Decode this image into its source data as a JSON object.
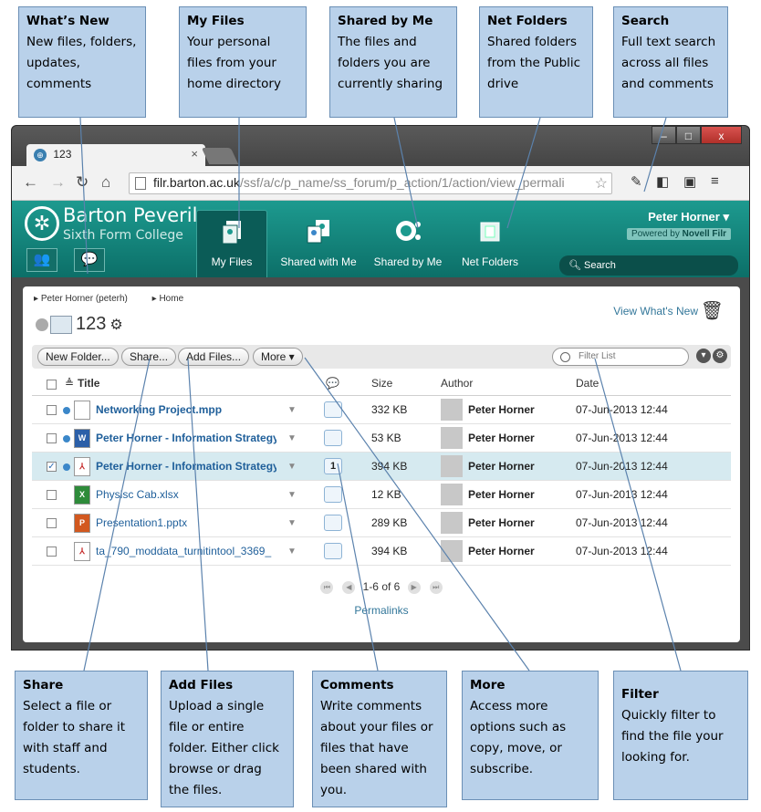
{
  "callouts_top": [
    {
      "title": "What’s New",
      "body": "New files, folders,\nupdates,\ncomments"
    },
    {
      "title": "My Files",
      "body": "Your personal\nfiles from your\nhome directory"
    },
    {
      "title": "Shared by Me",
      "body": "The files and\nfolders you are\ncurrently sharing"
    },
    {
      "title": "Net Folders",
      "body": "Shared folders\nfrom the Public\ndrive"
    },
    {
      "title": "Search",
      "body": "Full text search\nacross all files\nand comments"
    }
  ],
  "callouts_bottom": [
    {
      "title": "Share",
      "body": "Select a file or\nfolder to share it\nwith staff and\nstudents."
    },
    {
      "title": "Add Files",
      "body": "Upload a single\nfile or entire\nfolder. Either click\nbrowse or drag\nthe files."
    },
    {
      "title": "Comments",
      "body": "Write comments\nabout your files or\nfiles that have\nbeen shared with\nyou."
    },
    {
      "title": "More",
      "body": "Access more\noptions such as\ncopy, move, or\nsubscribe."
    },
    {
      "title": "Filter",
      "body": "Quickly filter to\nfind the file your\nlooking for."
    }
  ],
  "browser": {
    "tab_title": "123",
    "tab_close": "×",
    "url_host": "filr.barton.ac.uk",
    "url_path": "/ssf/a/c/p_name/ss_forum/p_action/1/action/view_permali",
    "win_min": "–",
    "win_max": "□",
    "win_close": "x"
  },
  "filr": {
    "college_name": "Barton Peveril",
    "college_sub": "Sixth Form College",
    "nav": [
      "My Files",
      "Shared with Me",
      "Shared by Me",
      "Net Folders"
    ],
    "user": "Peter Horner",
    "powered_by": "Powered by",
    "powered_product": "Novell Filr",
    "search_placeholder": "Search"
  },
  "content": {
    "breadcrumb": [
      "Peter Horner (peterh)",
      "Home"
    ],
    "folder_name": "123",
    "view_whats_new": "View What's New",
    "buttons": [
      "New Folder...",
      "Share...",
      "Add Files...",
      "More ▾"
    ],
    "filter_placeholder": "Filter List",
    "columns": {
      "title": "Title",
      "size": "Size",
      "author": "Author",
      "date": "Date"
    },
    "rows": [
      {
        "name": "Networking Project.mpp",
        "size": "332 KB",
        "author": "Peter Horner",
        "date": "07-Jun-2013 12:44",
        "comments": "",
        "type": "mpp",
        "unread": true,
        "selected": false
      },
      {
        "name": "Peter Horner - Information Strategy",
        "size": "53 KB",
        "author": "Peter Horner",
        "date": "07-Jun-2013 12:44",
        "comments": "",
        "type": "doc",
        "unread": true,
        "selected": false
      },
      {
        "name": "Peter Horner - Information Strategy",
        "size": "394 KB",
        "author": "Peter Horner",
        "date": "07-Jun-2013 12:44",
        "comments": "1",
        "type": "pdf",
        "unread": true,
        "selected": true
      },
      {
        "name": "Physisc Cab.xlsx",
        "size": "12 KB",
        "author": "Peter Horner",
        "date": "07-Jun-2013 12:44",
        "comments": "",
        "type": "xls",
        "unread": false,
        "selected": false
      },
      {
        "name": "Presentation1.pptx",
        "size": "289 KB",
        "author": "Peter Horner",
        "date": "07-Jun-2013 12:44",
        "comments": "",
        "type": "ppt",
        "unread": false,
        "selected": false
      },
      {
        "name": "ta_790_moddata_turnitintool_3369_",
        "size": "394 KB",
        "author": "Peter Horner",
        "date": "07-Jun-2013 12:44",
        "comments": "",
        "type": "pdf",
        "unread": false,
        "selected": false
      }
    ],
    "pager_text": "1-6 of 6",
    "permalinks": "Permalinks"
  },
  "colors": {
    "teal_header": "#1d9a8f",
    "callout_fill": "#b9d1ea",
    "link": "#1f5f9a",
    "selected_row": "#d6eaf0"
  }
}
